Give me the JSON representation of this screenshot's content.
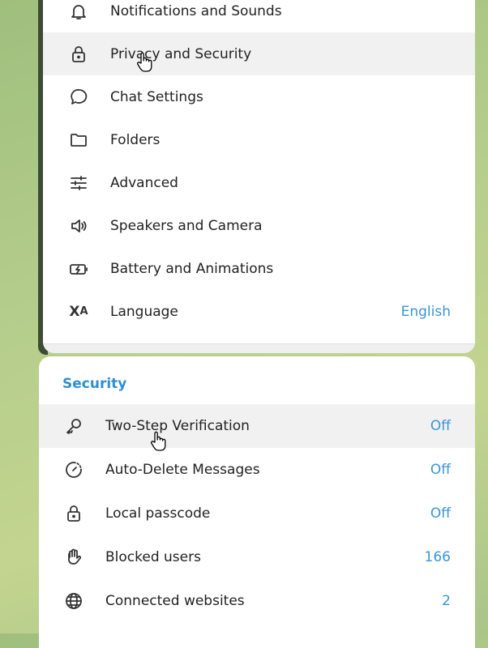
{
  "settings_menu": [
    {
      "label": "Notifications and Sounds",
      "icon": "bell-icon"
    },
    {
      "label": "Privacy and Security",
      "icon": "lock-icon",
      "hovered": true
    },
    {
      "label": "Chat Settings",
      "icon": "chat-bubble-icon"
    },
    {
      "label": "Folders",
      "icon": "folder-icon"
    },
    {
      "label": "Advanced",
      "icon": "sliders-icon"
    },
    {
      "label": "Speakers and Camera",
      "icon": "speaker-icon"
    },
    {
      "label": "Battery and Animations",
      "icon": "battery-icon"
    },
    {
      "label": "Language",
      "icon": "translate-icon",
      "value": "English"
    }
  ],
  "security": {
    "header": "Security",
    "items": [
      {
        "label": "Two-Step Verification",
        "icon": "key-icon",
        "value": "Off",
        "hovered": true
      },
      {
        "label": "Auto-Delete Messages",
        "icon": "timer-icon",
        "value": "Off"
      },
      {
        "label": "Local passcode",
        "icon": "lock-icon",
        "value": "Off"
      },
      {
        "label": "Blocked users",
        "icon": "hand-icon",
        "value": "166"
      },
      {
        "label": "Connected websites",
        "icon": "globe-icon",
        "value": "2"
      }
    ]
  },
  "colors": {
    "accent": "#2e8fd1",
    "hover": "#f1f1f1"
  }
}
